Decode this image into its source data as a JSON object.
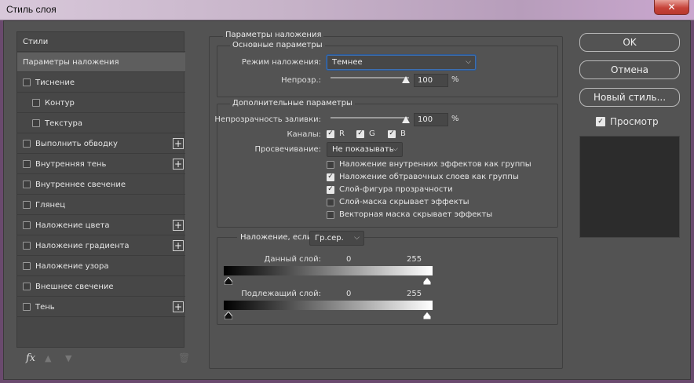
{
  "window": {
    "title": "Стиль слоя",
    "close_glyph": "✕"
  },
  "left_panel": {
    "items": [
      {
        "label": "Стили"
      },
      {
        "label": "Параметры наложения"
      },
      {
        "label": "Тиснение"
      },
      {
        "label": "Контур"
      },
      {
        "label": "Текстура"
      },
      {
        "label": "Выполнить обводку"
      },
      {
        "label": "Внутренняя тень"
      },
      {
        "label": "Внутреннее свечение"
      },
      {
        "label": "Глянец"
      },
      {
        "label": "Наложение цвета"
      },
      {
        "label": "Наложение градиента"
      },
      {
        "label": "Наложение узора"
      },
      {
        "label": "Внешнее свечение"
      },
      {
        "label": "Тень"
      }
    ],
    "plus_glyph": "+",
    "footer": {
      "fx": "fx",
      "up_glyph": "▲",
      "down_glyph": "▼",
      "trash_glyph": "🗑"
    }
  },
  "blending": {
    "title": "Параметры наложения",
    "general": {
      "title": "Основные параметры",
      "mode_label": "Режим наложения:",
      "mode_value": "Темнее",
      "opacity_label": "Непрозр.:",
      "opacity_value": "100",
      "opacity_unit": "%",
      "opacity_level": 1.0
    },
    "advanced": {
      "title": "Дополнительные параметры",
      "fill_label": "Непрозрачность заливки:",
      "fill_value": "100",
      "fill_unit": "%",
      "fill_level": 1.0,
      "channels_label": "Каналы:",
      "channels": [
        {
          "label": "R",
          "checked": true
        },
        {
          "label": "G",
          "checked": true
        },
        {
          "label": "B",
          "checked": true
        }
      ],
      "knockout_label": "Просвечивание:",
      "knockout_value": "Не показывать",
      "options": [
        {
          "label": "Наложение внутренних эффектов как группы",
          "checked": false
        },
        {
          "label": "Наложение обтравочных слоев как группы",
          "checked": true
        },
        {
          "label": "Слой-фигура прозрачности",
          "checked": true
        },
        {
          "label": "Слой-маска скрывает эффекты",
          "checked": false
        },
        {
          "label": "Векторная маска скрывает эффекты",
          "checked": false
        }
      ]
    },
    "blend_if": {
      "label": "Наложение, если:",
      "value": "Гр.сер.",
      "this_layer_label": "Данный слой:",
      "this_layer_min": "0",
      "this_layer_max": "255",
      "underlying_label": "Подлежащий слой:",
      "underlying_min": "0",
      "underlying_max": "255"
    }
  },
  "buttons": {
    "ok": "OK",
    "cancel": "Отмена",
    "new_style": "Новый стиль...",
    "preview_label": "Просмотр",
    "preview_checked": true
  },
  "colors": {
    "dialog_bg": "#535353",
    "panel_bg": "#474747",
    "accent_focus": "#3d6fb0"
  }
}
